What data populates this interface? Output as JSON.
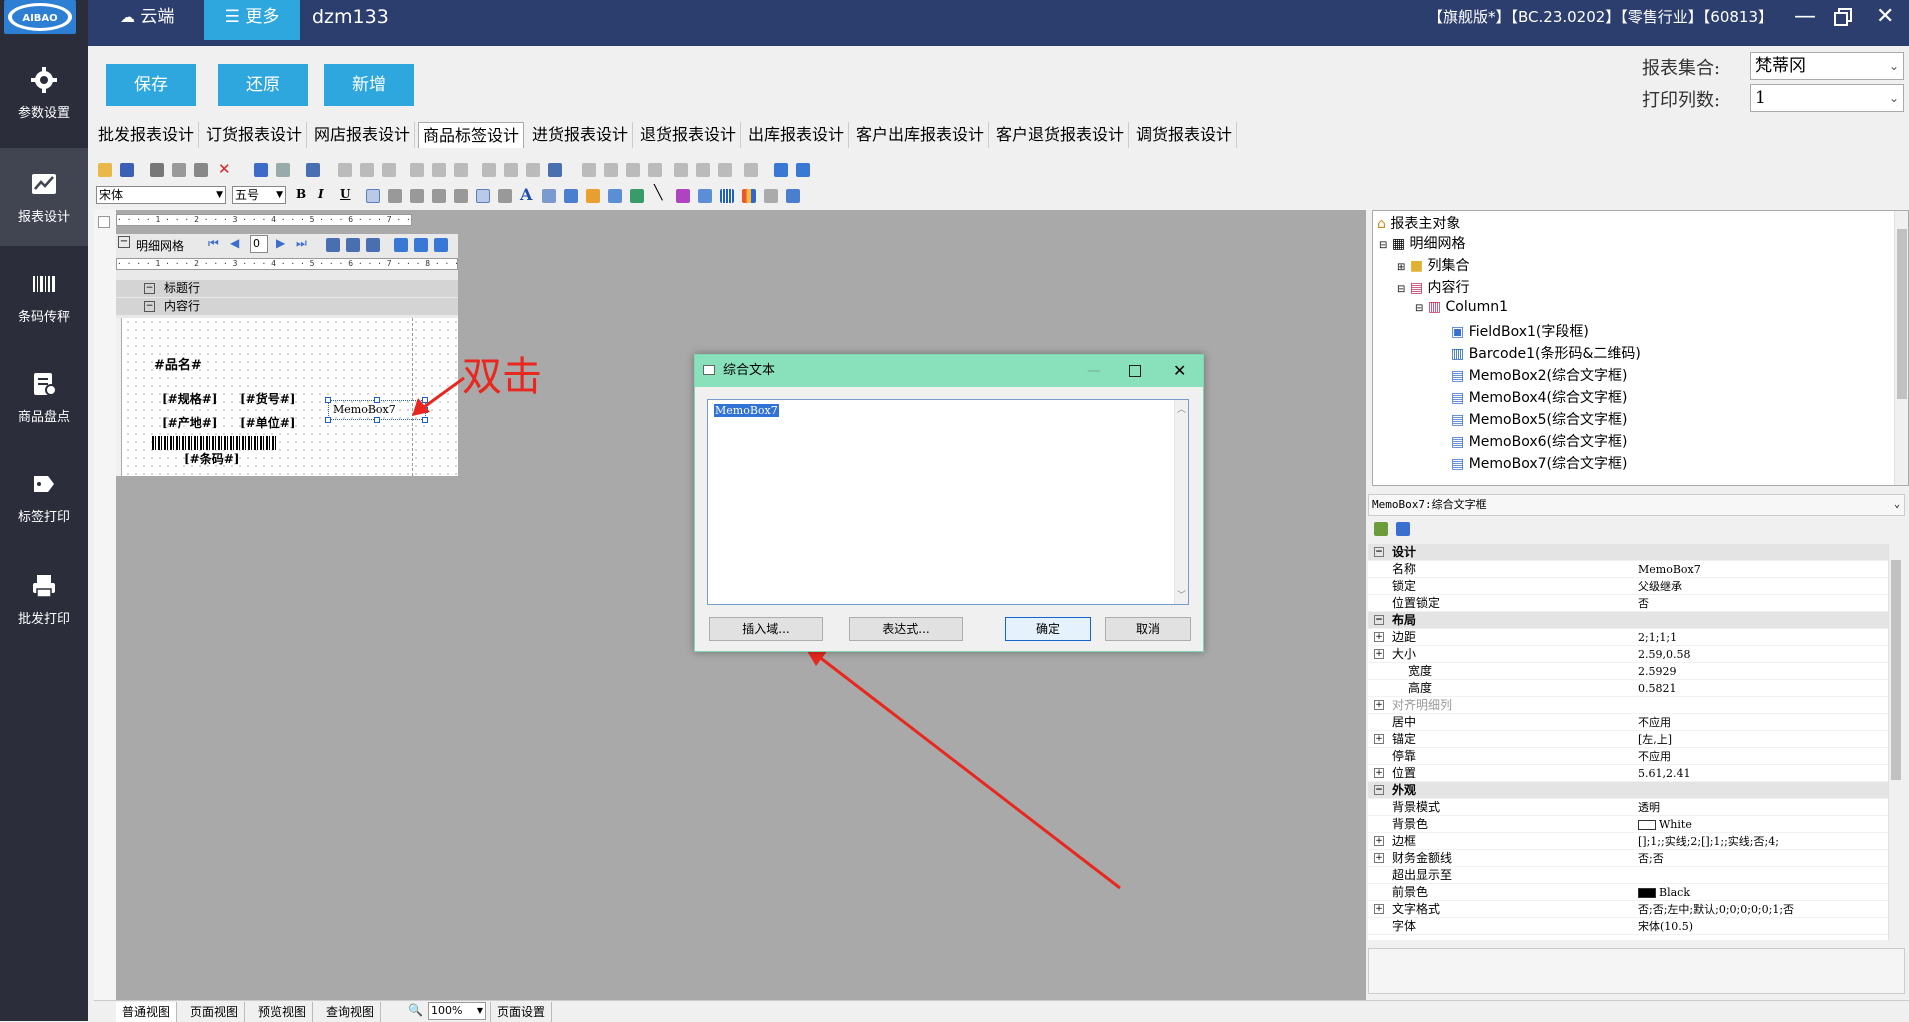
{
  "sidebar": {
    "logo_text": "AIBAO",
    "items": [
      {
        "label": "参数设置",
        "icon": "gear-icon"
      },
      {
        "label": "报表设计",
        "icon": "chart-icon"
      },
      {
        "label": "条码传秤",
        "icon": "barcode-icon"
      },
      {
        "label": "商品盘点",
        "icon": "inventory-icon"
      },
      {
        "label": "标签打印",
        "icon": "tag-icon"
      },
      {
        "label": "批发打印",
        "icon": "printer-icon"
      }
    ]
  },
  "topbar": {
    "cloud_label": "云端",
    "more_label": "更多",
    "user": "dzm133",
    "version_info": "【旗舰版*】【BC.23.0202】【零售行业】【60813】"
  },
  "toolbar": {
    "save_label": "保存",
    "restore_label": "还原",
    "add_label": "新增",
    "report_set_label": "报表集合:",
    "report_set_value": "梵蒂冈",
    "print_cols_label": "打印列数:",
    "print_cols_value": "1"
  },
  "tabs": [
    "批发报表设计",
    "订货报表设计",
    "网店报表设计",
    "商品标签设计",
    "进货报表设计",
    "退货报表设计",
    "出库报表设计",
    "客户出库报表设计",
    "客户退货报表设计",
    "调货报表设计"
  ],
  "format": {
    "font_name": "宋体",
    "font_size": "五号"
  },
  "design": {
    "grid_label": "明细网格",
    "page_value": "0",
    "band_title": "标题行",
    "band_content": "内容行",
    "fields": {
      "name": "#品名#",
      "spec": "[#规格#]",
      "item_no": "[#货号#]",
      "origin": "[#产地#]",
      "unit": "[#单位#]",
      "memo": "MemoBox7",
      "barcode": "[#条码#]"
    },
    "annotation": "双击"
  },
  "dialog": {
    "title": "综合文本",
    "content": "MemoBox7",
    "insert_button": "插入域...",
    "expr_button": "表达式...",
    "ok_button": "确定",
    "cancel_button": "取消"
  },
  "tree": {
    "root": "报表主对象",
    "grid": "明细网格",
    "columns": "列集合",
    "content_row": "内容行",
    "column1": "Column1",
    "children": [
      "FieldBox1(字段框)",
      "Barcode1(条形码&二维码)",
      "MemoBox2(综合文字框)",
      "MemoBox4(综合文字框)",
      "MemoBox5(综合文字框)",
      "MemoBox6(综合文字框)",
      "MemoBox7(综合文字框)"
    ]
  },
  "properties": {
    "title": "MemoBox7:综合文字框",
    "rows": [
      {
        "key": "设计",
        "value": "",
        "category": true
      },
      {
        "key": "名称",
        "value": "MemoBox7"
      },
      {
        "key": "锁定",
        "value": "父级继承"
      },
      {
        "key": "位置锁定",
        "value": "否"
      },
      {
        "key": "布局",
        "value": "",
        "category": true
      },
      {
        "key": "边距",
        "value": "2;1;1;1",
        "expand": true
      },
      {
        "key": "大小",
        "value": "2.59,0.58",
        "expand": true
      },
      {
        "key": "宽度",
        "value": "2.5929",
        "indent": true
      },
      {
        "key": "高度",
        "value": "0.5821",
        "indent": true
      },
      {
        "key": "对齐明细列",
        "value": "",
        "expand": true,
        "dim": true
      },
      {
        "key": "居中",
        "value": "不应用"
      },
      {
        "key": "锚定",
        "value": "[左,上]",
        "expand": true
      },
      {
        "key": "停靠",
        "value": "不应用"
      },
      {
        "key": "位置",
        "value": "5.61,2.41",
        "expand": true
      },
      {
        "key": "外观",
        "value": "",
        "category": true
      },
      {
        "key": "背景模式",
        "value": "透明"
      },
      {
        "key": "背景色",
        "value": "White",
        "swatch": "#ffffff"
      },
      {
        "key": "边框",
        "value": "[];1;;实线;2;[];1;;实线;否;4;",
        "expand": true
      },
      {
        "key": "财务金额线",
        "value": "否;否",
        "expand": true
      },
      {
        "key": "超出显示至",
        "value": ""
      },
      {
        "key": "前景色",
        "value": "Black",
        "swatch": "#000000"
      },
      {
        "key": "文字格式",
        "value": "否;否;左中;默认;0;0;0;0;0;1;否",
        "expand": true
      },
      {
        "key": "字体",
        "value": "宋体(10.5)"
      }
    ]
  },
  "statusbar": {
    "tabs": [
      "普通视图",
      "页面视图",
      "预览视图",
      "查询视图"
    ],
    "zoom": "100%",
    "page_setup": "页面设置"
  },
  "colors": {
    "accent": "#2ea7de",
    "sidebar": "#2b2e3a",
    "topbar": "#2c3e6e",
    "dialog_title": "#88e1bb",
    "annotation": "#e8281e"
  }
}
